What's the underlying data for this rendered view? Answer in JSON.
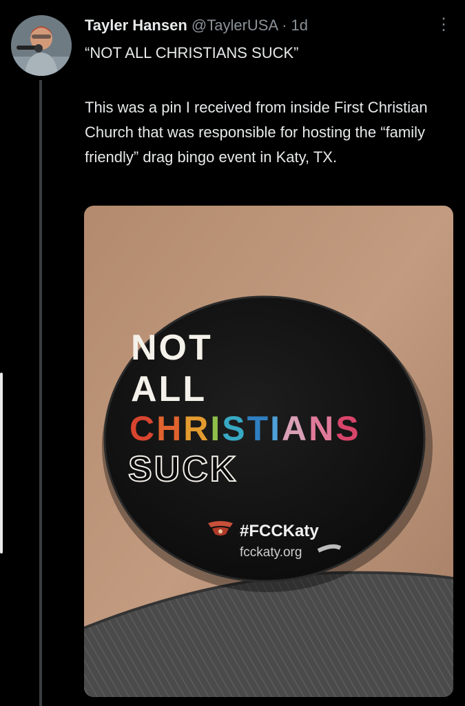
{
  "tweet": {
    "display_name": "Tayler Hansen",
    "handle": "@TaylerUSA",
    "separator": "·",
    "time": "1d",
    "title": "“NOT ALL CHRISTIANS SUCK”",
    "body": "This was a pin I received from inside  First Christian Church that was responsible for hosting the “family friendly” drag bingo event in Katy, TX.",
    "more_icon": "⋮"
  },
  "pin": {
    "line1": "NOT",
    "line2": "ALL",
    "line3_letters": [
      {
        "char": "C",
        "color": "#d8452f"
      },
      {
        "char": "H",
        "color": "#e0632e"
      },
      {
        "char": "R",
        "color": "#e39a2f"
      },
      {
        "char": "I",
        "color": "#8fbf4a"
      },
      {
        "char": "S",
        "color": "#38a9c4"
      },
      {
        "char": "T",
        "color": "#2f7fc1"
      },
      {
        "char": "I",
        "color": "#4ea0d8"
      },
      {
        "char": "A",
        "color": "#d9a0b6"
      },
      {
        "char": "N",
        "color": "#e07a9a"
      },
      {
        "char": "S",
        "color": "#d8456a"
      }
    ],
    "line4": "SUCK",
    "hashtag": "#FCCKaty",
    "website": "fcckaty.org"
  },
  "colors": {
    "background": "#000000",
    "text": "#e7e9ea",
    "muted": "#8b9298"
  }
}
